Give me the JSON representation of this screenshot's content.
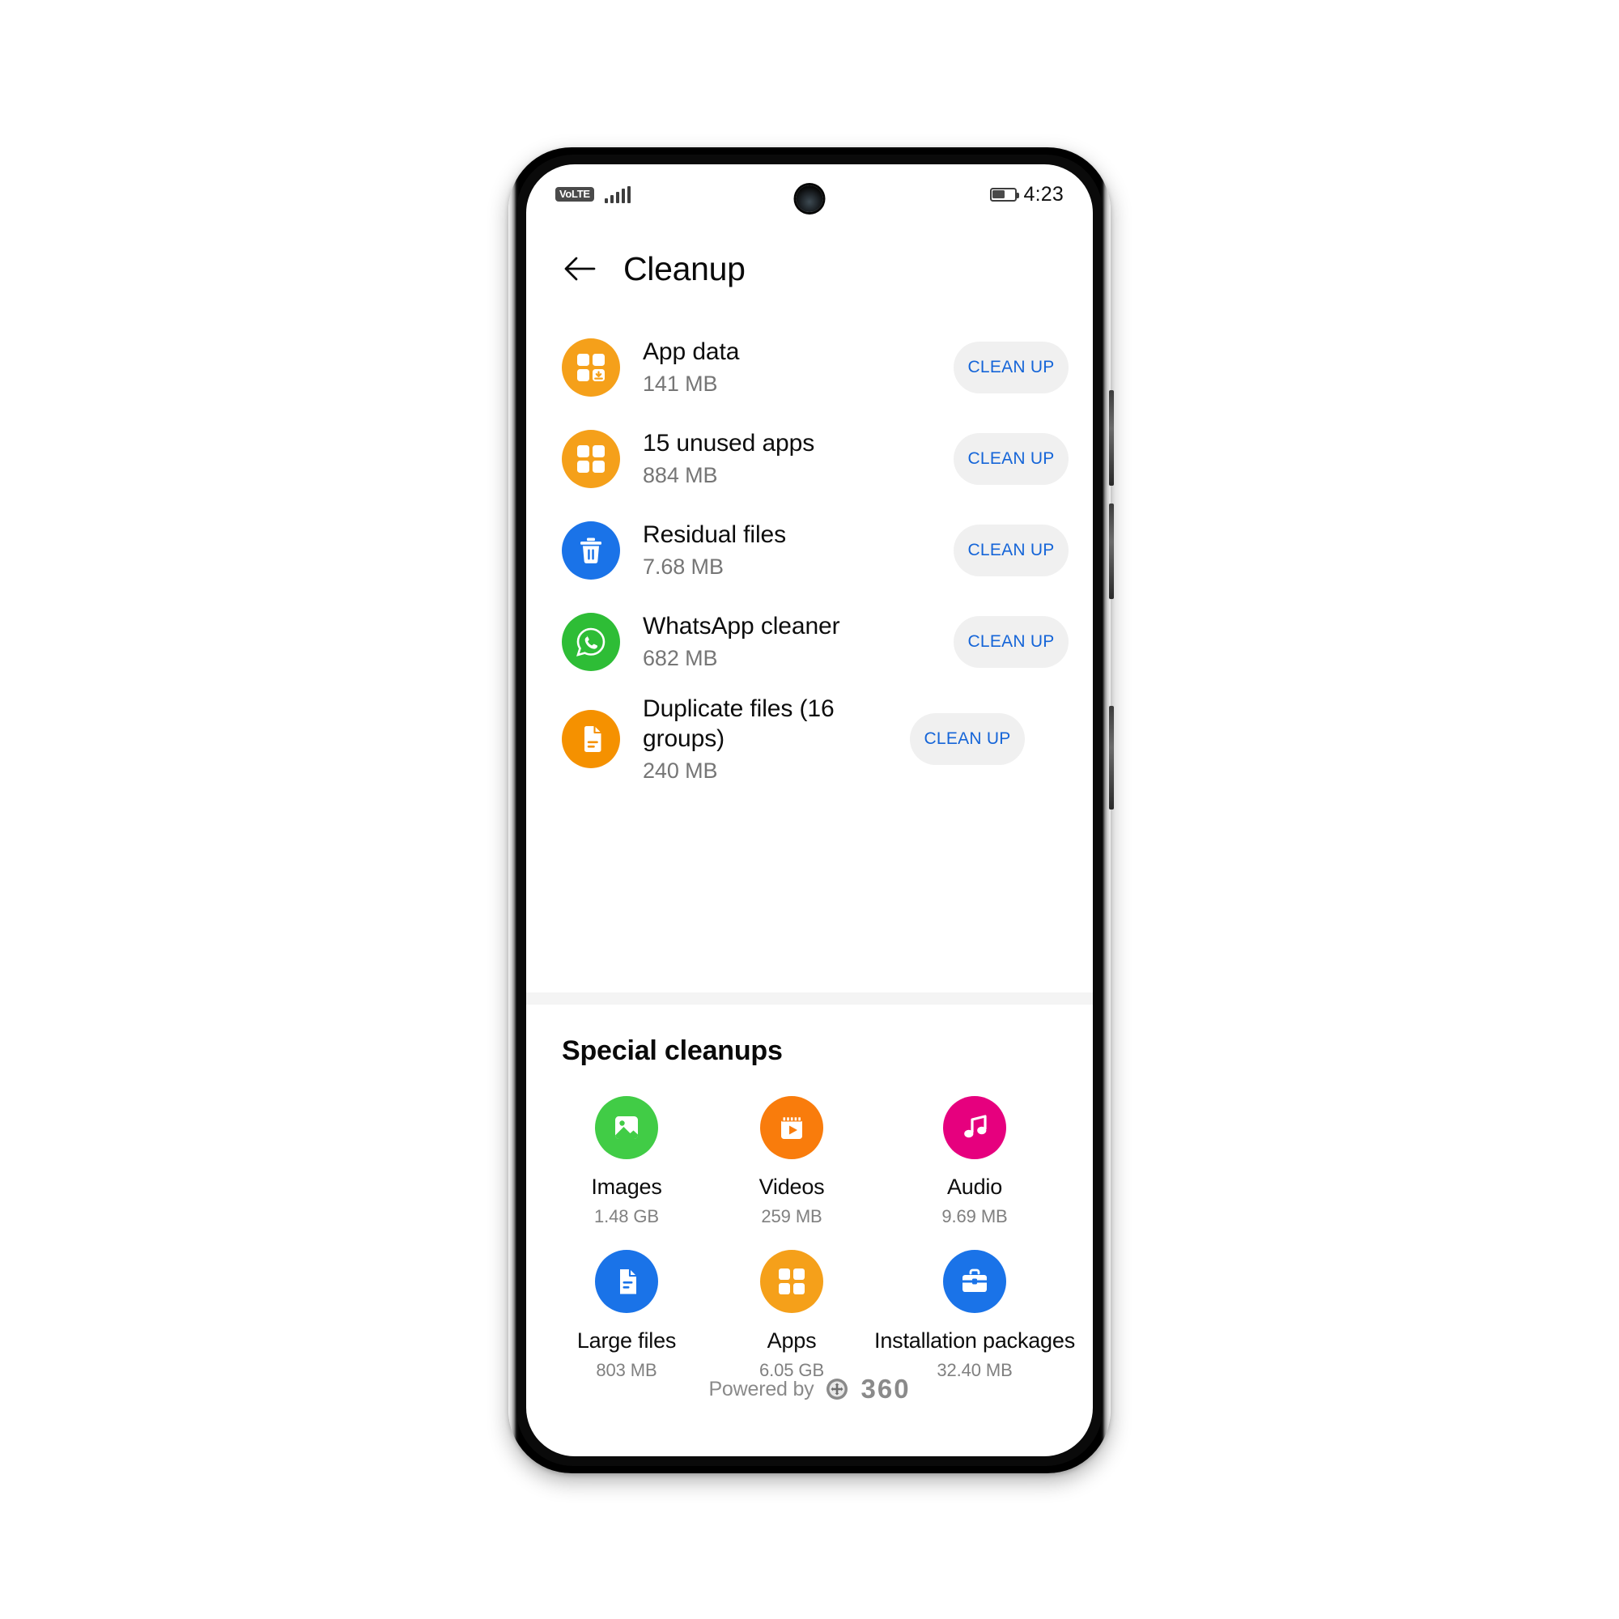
{
  "status_bar": {
    "volte_label": "VoLTE",
    "signal_icon": "signal-bars-icon",
    "battery_icon": "battery-icon",
    "battery_level_percent": 58,
    "time": "4:23"
  },
  "header": {
    "back_icon": "back-arrow-icon",
    "title": "Cleanup"
  },
  "cleanup_list": [
    {
      "icon": "app-data-icon",
      "icon_color": "#f5a01a",
      "title": "App data",
      "size": "141 MB",
      "action_label": "CLEAN UP"
    },
    {
      "icon": "apps-grid-icon",
      "icon_color": "#f5a01a",
      "title": "15 unused apps",
      "size": "884 MB",
      "action_label": "CLEAN UP"
    },
    {
      "icon": "trash-icon",
      "icon_color": "#1a73e8",
      "title": "Residual files",
      "size": "7.68 MB",
      "action_label": "CLEAN UP"
    },
    {
      "icon": "whatsapp-icon",
      "icon_color": "#2ebd36",
      "title": "WhatsApp cleaner",
      "size": "682 MB",
      "action_label": "CLEAN UP"
    },
    {
      "icon": "document-icon",
      "icon_color": "#f59100",
      "title": "Duplicate files (16 groups)",
      "size": "240 MB",
      "action_label": "CLEAN UP"
    }
  ],
  "special_cleanups": {
    "section_title": "Special cleanups",
    "items": [
      {
        "icon": "image-icon",
        "icon_color": "#41cc46",
        "label": "Images",
        "size": "1.48 GB"
      },
      {
        "icon": "video-icon",
        "icon_color": "#f97c0c",
        "label": "Videos",
        "size": "259 MB"
      },
      {
        "icon": "audio-note-icon",
        "icon_color": "#e6007e",
        "label": "Audio",
        "size": "9.69 MB"
      },
      {
        "icon": "large-file-icon",
        "icon_color": "#1a73e8",
        "label": "Large files",
        "size": "803 MB"
      },
      {
        "icon": "apps-grid-icon",
        "icon_color": "#f5a01a",
        "label": "Apps",
        "size": "6.05 GB"
      },
      {
        "icon": "installation-package-icon",
        "icon_color": "#1a73e8",
        "label": "Installation packages",
        "size": "32.40 MB"
      }
    ]
  },
  "footer": {
    "powered_by_label": "Powered by",
    "brand_icon": "360-shield-icon",
    "brand_name": "360"
  },
  "theme": {
    "accent_blue": "#1565d8",
    "button_bg": "#f0f0f0",
    "divider": "#f4f4f4",
    "text_primary": "#0d0d0d",
    "text_secondary": "#767676"
  }
}
